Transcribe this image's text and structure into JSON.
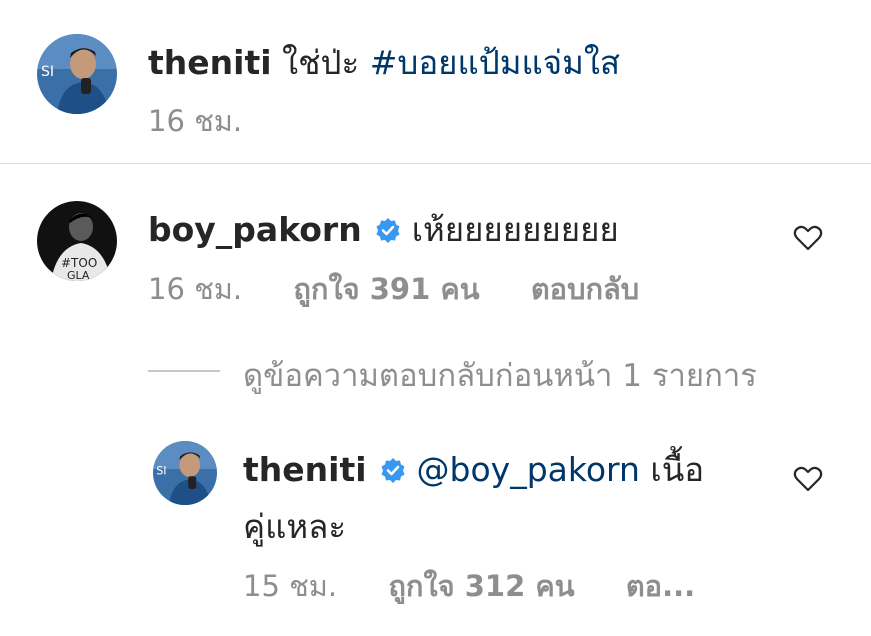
{
  "post": {
    "username": "theniti",
    "caption_text": "ใช่ป่ะ",
    "hashtag": "#บอยแป้มแจ่มใส",
    "time": "16 ชม."
  },
  "comment": {
    "username": "boy_pakorn",
    "text": "เห้ยยยยยยยยย",
    "time": "16 ชม.",
    "likes": "ถูกใจ 391 คน",
    "reply_label": "ตอบกลับ"
  },
  "view_replies_label": "ดูข้อความตอบกลับก่อนหน้า 1 รายการ",
  "reply": {
    "username": "theniti",
    "mention": "@boy_pakorn",
    "text_line1": "เนื้อ",
    "text_line2": "คู่แหละ",
    "time": "15 ชม.",
    "likes": "ถูกใจ 312 คน",
    "reply_label": "ตอ..."
  },
  "colors": {
    "primary_text": "#262626",
    "secondary_text": "#8e8e8e",
    "link": "#00376b",
    "verified_badge": "#3897f0"
  },
  "icons": [
    "avatar-theniti",
    "avatar-boy-pakorn",
    "verified-badge-icon",
    "heart-icon"
  ]
}
